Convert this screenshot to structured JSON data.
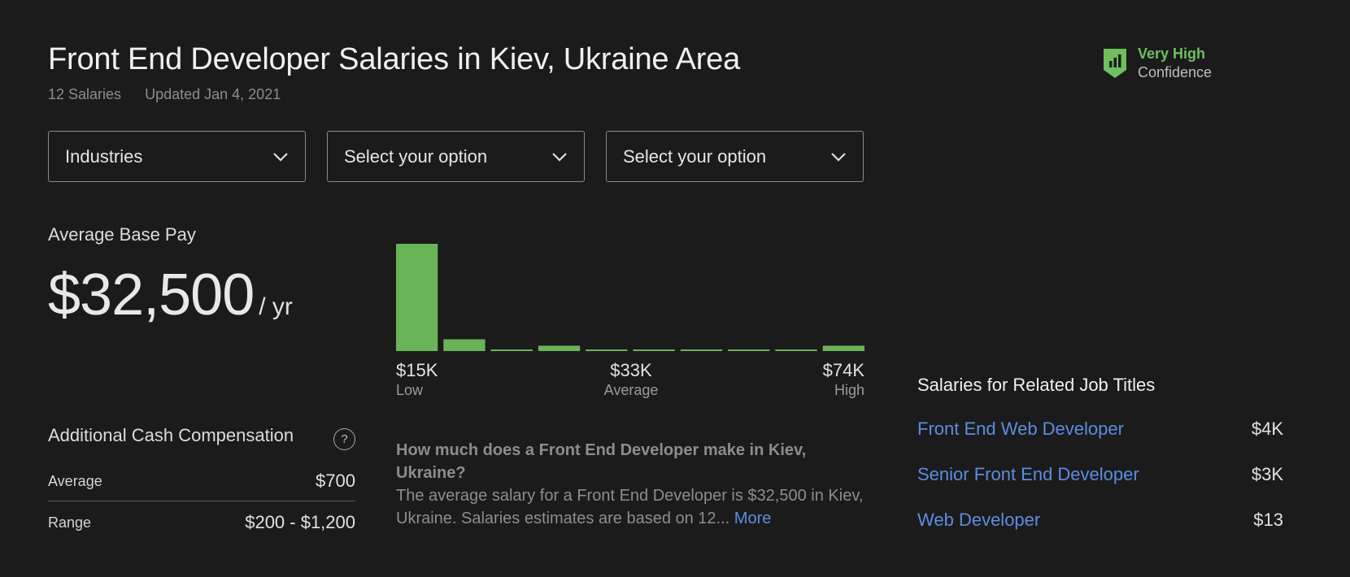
{
  "header": {
    "title": "Front End Developer Salaries in Kiev, Ukraine Area",
    "salary_count": "12 Salaries",
    "updated": "Updated Jan 4, 2021"
  },
  "confidence": {
    "level": "Very High",
    "label": "Confidence",
    "icon": "shield-chart-icon",
    "color": "#6fbf5f"
  },
  "filters": [
    {
      "label": "Industries",
      "icon": "chevron-down-icon"
    },
    {
      "label": "Select your option",
      "icon": "chevron-down-icon"
    },
    {
      "label": "Select your option",
      "icon": "chevron-down-icon"
    }
  ],
  "base_pay": {
    "label": "Average Base Pay",
    "amount": "$32,500",
    "unit": "/ yr"
  },
  "chart_data": {
    "type": "bar",
    "values": [
      100,
      11,
      1,
      5,
      1,
      1,
      1,
      1,
      1,
      5
    ],
    "bar_color": "#6ab356",
    "axis": {
      "low": {
        "value": "$15K",
        "label": "Low"
      },
      "average": {
        "value": "$33K",
        "label": "Average"
      },
      "high": {
        "value": "$74K",
        "label": "High"
      }
    }
  },
  "additional_cash": {
    "title": "Additional Cash Compensation",
    "help_icon": "question-circle-icon",
    "help_glyph": "?",
    "rows": [
      {
        "label": "Average",
        "value": "$700"
      },
      {
        "label": "Range",
        "value": "$200 - $1,200"
      }
    ]
  },
  "faq": {
    "question": "How much does a Front End Developer make in Kiev, Ukraine?",
    "answer": "The average salary for a Front End Developer is $32,500 in Kiev, Ukraine. Salaries estimates are based on 12...",
    "more_link": "More"
  },
  "related": {
    "title": "Salaries for Related Job Titles",
    "items": [
      {
        "name": "Front End Web Developer",
        "pay": "$4K"
      },
      {
        "name": "Senior Front End Developer",
        "pay": "$3K"
      },
      {
        "name": "Web Developer",
        "pay": "$13"
      }
    ]
  }
}
